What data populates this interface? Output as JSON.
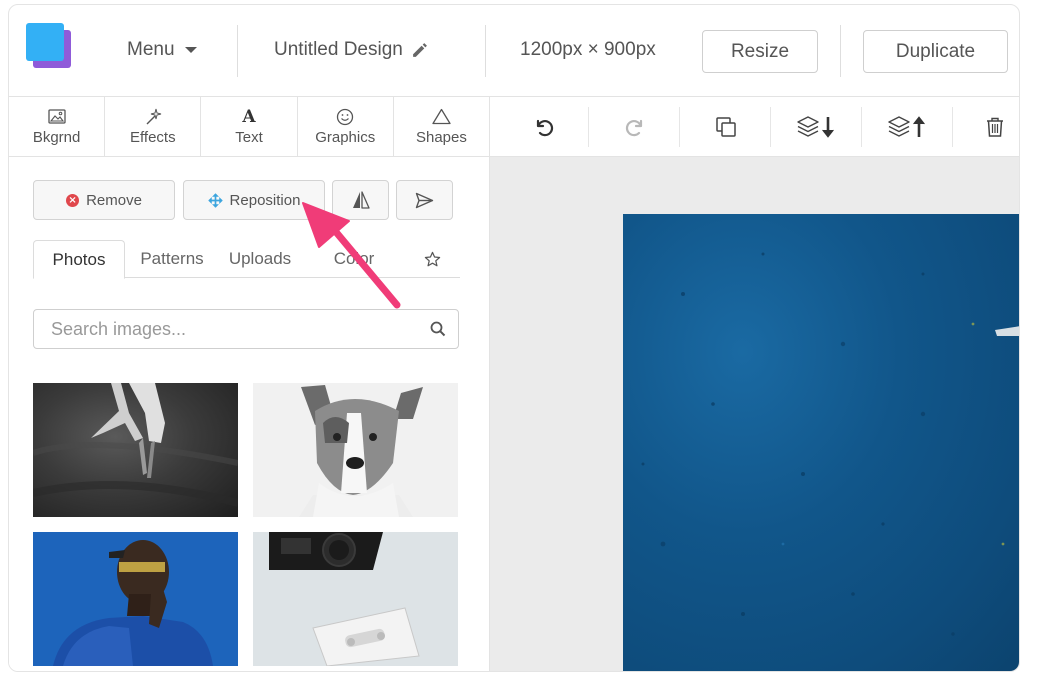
{
  "header": {
    "menu_label": "Menu",
    "design_title": "Untitled Design",
    "dimensions": "1200px × 900px",
    "resize_label": "Resize",
    "duplicate_label": "Duplicate"
  },
  "tool_tabs": [
    {
      "label": "Bkgrnd",
      "icon": "image-icon"
    },
    {
      "label": "Effects",
      "icon": "magic-wand-icon"
    },
    {
      "label": "Text",
      "icon": "text-icon",
      "glyph": "A"
    },
    {
      "label": "Graphics",
      "icon": "smiley-icon"
    },
    {
      "label": "Shapes",
      "icon": "triangle-icon"
    }
  ],
  "canvas_toolbar": [
    "undo-icon",
    "redo-icon",
    "copy-icon",
    "send-backward-icon",
    "bring-forward-icon",
    "trash-icon"
  ],
  "panel": {
    "remove_label": "Remove",
    "reposition_label": "Reposition",
    "subtabs": [
      "Photos",
      "Patterns",
      "Uploads",
      "Color"
    ],
    "active_subtab": "Photos",
    "search_placeholder": "Search images..."
  },
  "colors": {
    "accent_arrow": "#f03c78",
    "logo_front": "#33b0f5",
    "logo_back": "#8f5bd9",
    "canvas_blue": "#11568a",
    "remove_red": "#e0474c",
    "reposition_blue": "#3da5de"
  }
}
